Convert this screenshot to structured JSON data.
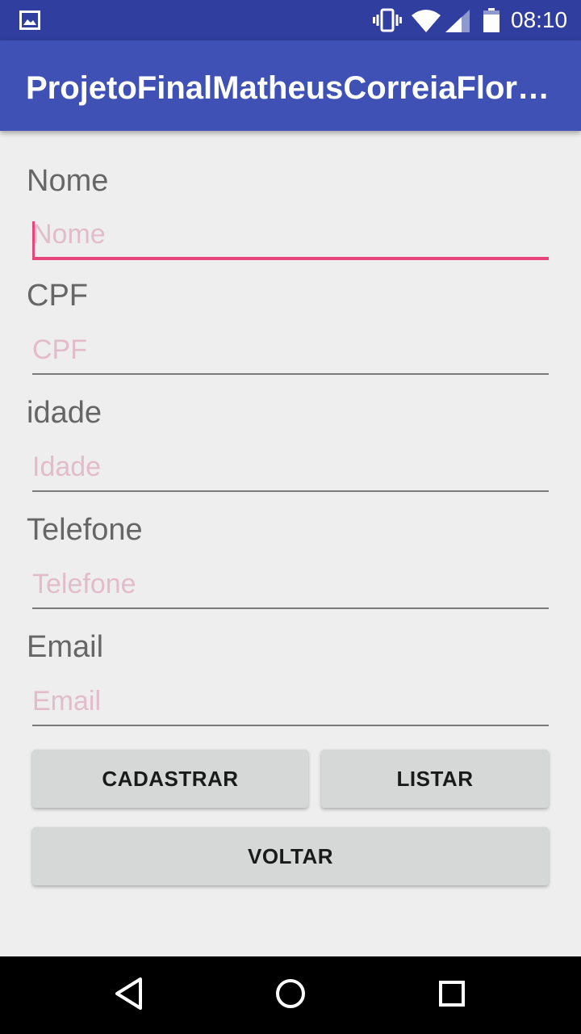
{
  "status_bar": {
    "time": "08:10",
    "icons": [
      "image-notification-icon",
      "vibrate-icon",
      "wifi-icon",
      "signal-icon",
      "battery-icon"
    ]
  },
  "app_bar": {
    "title": "ProjetoFinalMatheusCorreiaFlorencio"
  },
  "form": {
    "fields": [
      {
        "label": "Nome",
        "placeholder": "Nome",
        "value": ""
      },
      {
        "label": "CPF",
        "placeholder": "CPF",
        "value": ""
      },
      {
        "label": "idade",
        "placeholder": "Idade",
        "value": ""
      },
      {
        "label": "Telefone",
        "placeholder": "Telefone",
        "value": ""
      },
      {
        "label": "Email",
        "placeholder": "Email",
        "value": ""
      }
    ]
  },
  "buttons": {
    "cadastrar": "CADASTRAR",
    "listar": "LISTAR",
    "voltar": "VOLTAR"
  },
  "nav_bar": {
    "icons": [
      "back-icon",
      "home-icon",
      "recents-icon"
    ]
  },
  "colors": {
    "primary": "#3f51b5",
    "primary_dark": "#303f9f",
    "accent": "#e8457e",
    "hint": "#e2bccb",
    "background": "#eeeeee"
  }
}
